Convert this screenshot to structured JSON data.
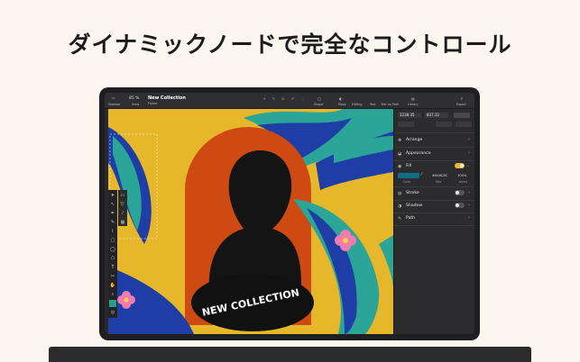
{
  "headline": "ダイナミックノードで完全なコントロール",
  "toolbar": {
    "zoom": "85 %",
    "doc_title": "New Collection",
    "doc_sub": "Folder",
    "left_labels": [
      "Sidebar",
      "View"
    ],
    "right_labels": [
      "Shape",
      "Mask",
      "Editing",
      "Text",
      "Text on Path",
      "Library",
      "Export"
    ]
  },
  "panel": {
    "x_value": "1238.35",
    "y_value": "837.32",
    "sections": {
      "arrange": "Arrange",
      "appearance": "Appearance",
      "fill": "Fill",
      "stroke": "Stroke",
      "shadow": "Shadow",
      "path": "Path"
    },
    "fill_hex": "#0A6C8C",
    "fill_opacity": "100%",
    "fill_sub": [
      "Color",
      "Hex",
      "Alpha"
    ],
    "fill_color": "#0f6e83",
    "fill_enabled": true,
    "stroke_enabled": false,
    "shadow_enabled": false
  },
  "artwork": {
    "text": "NEW COLLECTION",
    "bg_color": "#e6b72a",
    "arch_color": "#cf4a12",
    "leaf_blue": "#1f3ea5",
    "leaf_teal": "#2aa597"
  }
}
